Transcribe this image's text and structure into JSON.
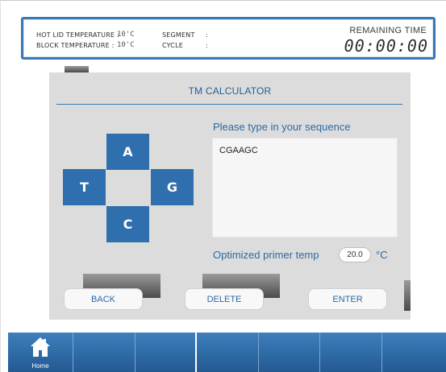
{
  "status": {
    "hot_lid_label": "HOT LID TEMPERATURE :",
    "hot_lid_value": "10'C",
    "block_label": "BLOCK TEMPERATURE  :",
    "block_value": "10'C",
    "segment_label": "SEGMENT",
    "segment_sep": ":",
    "cycle_label": "CYCLE",
    "cycle_sep": ":",
    "remaining_label": "REMAINING TIME",
    "remaining_value": "00:00:00"
  },
  "dialog": {
    "title": "TM CALCULATOR",
    "keys": {
      "a": "A",
      "t": "T",
      "g": "G",
      "c": "C"
    },
    "prompt": "Please type in your sequence",
    "sequence": "CGAAGC",
    "primer_label": "Optimized primer temp",
    "primer_value": "20.0",
    "primer_unit": "°C",
    "back_label": "BACK",
    "delete_label": "DELETE",
    "enter_label": "ENTER"
  },
  "nav": {
    "home_label": "Home"
  },
  "colors": {
    "accent": "#2f6fad",
    "nav": "#2e6aa5",
    "dialog_bg": "#dcdcdc"
  }
}
